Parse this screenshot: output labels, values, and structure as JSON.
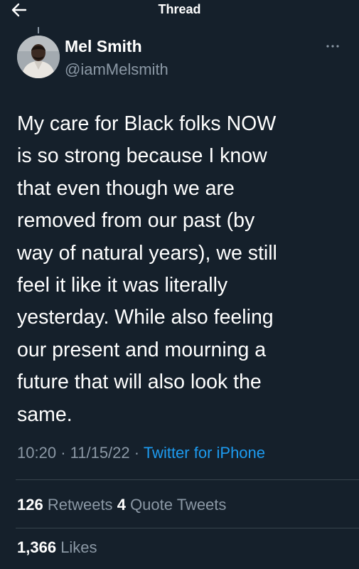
{
  "header": {
    "title": "Thread",
    "back_icon": "back-arrow-icon"
  },
  "tweet": {
    "author": {
      "display_name": "Mel Smith",
      "handle": "@iamMelsmith"
    },
    "more_icon": "more-options-icon",
    "text_lines": [
      "My care for Black folks NOW",
      "is so strong because I know",
      "that even though we are",
      "removed from our past (by",
      "way of natural years), we still",
      "feel it like it was literally",
      "yesterday. While also feeling",
      "our present and mourning a",
      "future that will also look the",
      "same."
    ],
    "time": "10:20",
    "separator": "·",
    "date": "11/15/22",
    "source": "Twitter for iPhone"
  },
  "stats": {
    "retweets_count": "126",
    "retweets_label": "Retweets",
    "quotes_count": "4",
    "quotes_label": "Quote Tweets",
    "likes_count": "1,366",
    "likes_label": "Likes"
  },
  "colors": {
    "background": "#15202b",
    "text_primary": "#ffffff",
    "text_secondary": "#8b98a5",
    "accent": "#1d9bf0",
    "divider": "#38444d"
  }
}
